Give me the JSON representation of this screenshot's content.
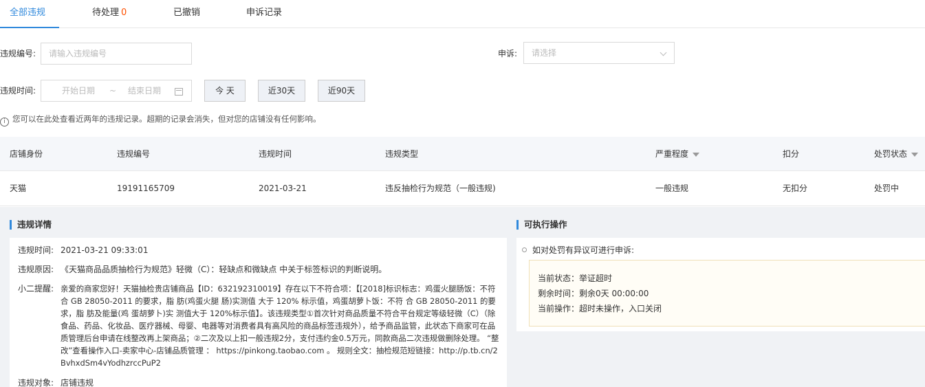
{
  "tabs": [
    {
      "label": "全部违规"
    },
    {
      "label": "待处理",
      "count": "0"
    },
    {
      "label": "已撤销"
    },
    {
      "label": "申诉记录"
    }
  ],
  "filters": {
    "violation_no_label": "违规编号:",
    "violation_no_placeholder": "请输入违规编号",
    "appeal_label": "申诉:",
    "appeal_placeholder": "请选择",
    "time_label": "违规时间:",
    "start_placeholder": "开始日期",
    "tilde": "~",
    "end_placeholder": "结束日期",
    "btn_today": "今 天",
    "btn_30": "近30天",
    "btn_90": "近90天"
  },
  "notice": "您可以在此处查看近两年的违规记录。超期的记录会消失，但对您的店铺没有任何影响。",
  "table": {
    "headers": [
      "店铺身份",
      "违规编号",
      "违规时间",
      "违规类型",
      "严重程度",
      "扣分",
      "处罚状态"
    ],
    "rows": [
      [
        "天猫",
        "19191165709",
        "2021-03-21",
        "违反抽检行为规范（一般违规)",
        "一般违规",
        "无扣分",
        "处罚中"
      ]
    ]
  },
  "detail": {
    "title": "违规详情",
    "fields": [
      {
        "label": "违规时间:",
        "value": "2021-03-21 09:33:01"
      },
      {
        "label": "违规原因:",
        "value": "《天猫商品品质抽检行为规范》轻微（C）：轻缺点和微缺点 中关于标签标识的判断说明。"
      },
      {
        "label": "小二提醒:",
        "value": "亲爱的商家您好！天猫抽检贵店铺商品【ID：632192310019】存在以下不符合项：【[2018]标识标志：鸡蛋火腿肠饭：不符 合 GB 28050-2011 的要求，脂 肪(鸡蛋火腿 肠)实测值 大于 120% 标示值，鸡蛋胡萝卜饭：不符 合 GB 28050-2011 的要求，脂 肪及能量(鸡 蛋胡萝卜)实 测值大于 120%标示值】。该违规类型①首次针对商品质量不符合平台规定等级轻微（C）（除食品、药品、化妆品、医疗器械、母婴、电器等对消费者具有高风险的商品标签违规外），给予商品监管，此状态下商家可在品质管理后台申请在线整改再上架商品；②二次及以上扣一般违规2分，支付违约金0.5万元，同款商品二次违规做删除处理。 “整改”查看操作入口-卖家中心-店铺品质管理 ： https://pinkong.taobao.com 。 规则全文：抽检规范短链接：http://p.tb.cn/2BvhxdSm4vYodhzrccPuP2"
      },
      {
        "label": "违规对象:",
        "value": "店铺违规"
      }
    ]
  },
  "actions": {
    "title": "可执行操作",
    "item": "如对处罚有异议可进行申诉:",
    "status_lines": [
      "当前状态：举证超时",
      "剩余时间：剩余0天 00:00:00",
      "当前操作：超时未操作，入口关闭"
    ]
  }
}
